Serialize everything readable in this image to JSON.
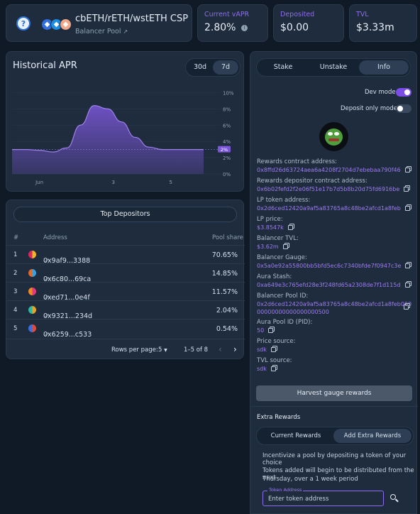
{
  "pool": {
    "name": "cbETH/rETH/wstETH CSP",
    "subtitle": "Balancer Pool",
    "main_icon": "balancer-pool-icon",
    "token_icons": [
      "cbeth-token-icon",
      "reth-token-icon",
      "wsteth-token-icon"
    ]
  },
  "stats": {
    "current_vapr": {
      "label": "Current vAPR",
      "value": "2.80%"
    },
    "deposited": {
      "label": "Deposited",
      "value": "$0.00"
    },
    "tvl": {
      "label": "TVL",
      "value": "$3.33m"
    }
  },
  "historical_apr": {
    "title": "Historical APR",
    "ranges": [
      "30d",
      "7d"
    ],
    "selected_range": "7d"
  },
  "chart_data": {
    "type": "area",
    "title": "",
    "x_tick_labels": [
      "Jun",
      "3",
      "5"
    ],
    "y_tick_labels": [
      "10%",
      "8%",
      "6%",
      "4%",
      "2%",
      "0%"
    ],
    "ylim": [
      0,
      11
    ],
    "grid": true,
    "current_value_label": "2%",
    "x": [
      0,
      0.5,
      1,
      1.5,
      2,
      2.5,
      3,
      3.5,
      4,
      4.5,
      5,
      5.5,
      6,
      6.5,
      7
    ],
    "values": [
      3.0,
      3.0,
      2.9,
      2.7,
      3.2,
      6.0,
      8.4,
      8.0,
      6.4,
      4.5,
      3.3,
      3.0,
      3.0,
      3.0,
      3.0
    ],
    "series_color": "#7b57d9"
  },
  "depositors": {
    "title": "Top Depositors",
    "columns": [
      "#",
      "Address",
      "Pool share"
    ],
    "rows": [
      {
        "rank": "1",
        "address": "0x9af9...3388",
        "share": "70.65%",
        "colors": [
          "#f0b429",
          "#d62b5c"
        ]
      },
      {
        "rank": "2",
        "address": "0x6c80...69ca",
        "share": "14.85%",
        "colors": [
          "#3aa0e0",
          "#e06b2b"
        ]
      },
      {
        "rank": "3",
        "address": "0xed71...0e4f",
        "share": "11.57%",
        "colors": [
          "#e03b7a",
          "#f08a24"
        ]
      },
      {
        "rank": "4",
        "address": "0x9321...234d",
        "share": "2.04%",
        "colors": [
          "#e6a42a",
          "#2fb7a0"
        ]
      },
      {
        "rank": "5",
        "address": "0x6259...c533",
        "share": "0.54%",
        "colors": [
          "#e04a3a",
          "#3a6ee0"
        ]
      }
    ],
    "rows_per_page_label": "Rows per page:",
    "rows_per_page": "5",
    "range": "1–5 of 8"
  },
  "tabs": [
    "Stake",
    "Unstake",
    "Info"
  ],
  "active_tab": "Info",
  "toggles": {
    "dev_mode": {
      "label": "Dev mode",
      "on": true
    },
    "deposit_only": {
      "label": "Deposit only mode",
      "on": false
    }
  },
  "info": {
    "rewards_contract_label": "Rewards contract address:",
    "rewards_contract": "0x8ffd26d63724aea6a4208f2704d7ebebaa790f46",
    "rewards_depositor_label": "Rewards depositor contract address:",
    "rewards_depositor": "0x6b02fefd2f2e06f51e17b7d5b8b20d75fd6916be",
    "lp_token_label": "LP token address:",
    "lp_token": "0x2d6ced12420a9af5a83765a8c48be2afcd1a8feb",
    "lp_price_label": "LP price:",
    "lp_price": "$3.8547k",
    "balancer_tvl_label": "Balancer TVL:",
    "balancer_tvl": "$3.62m",
    "gauge_label": "Balancer Gauge:",
    "gauge": "0x5a0e92a55800bb5bfd5ec6c7340bfde7f0947c3e",
    "aura_stash_label": "Aura Stash:",
    "aura_stash": "0xa649e3c765efd28e3f248fd65a2308de7f1d115d",
    "pool_id_label": "Balancer Pool ID:",
    "pool_id_line1": "0x2d6ced12420a9af5a83765a8c48be2afcd1a8feb000",
    "pool_id_line2": "00000000000000000500",
    "aura_pid_label": "Aura Pool ID (PID):",
    "aura_pid": "50",
    "price_source_label": "Price source:",
    "price_source": "sdk",
    "tvl_source_label": "TVL source:",
    "tvl_source": "sdk"
  },
  "harvest_label": "Harvest gauge rewards",
  "extra_rewards": {
    "title": "Extra Rewards",
    "tabs": [
      "Current Rewards",
      "Add Extra Rewards"
    ],
    "active_tab": "Add Extra Rewards",
    "text1": "Incentivize a pool by depositing a token of your choice",
    "text2_line1": "Tokens added will begin to be distributed from the next",
    "text2_line2": "Thursday, over a 1 week period",
    "input_label": "Token Address",
    "input_placeholder": "Enter token address"
  }
}
